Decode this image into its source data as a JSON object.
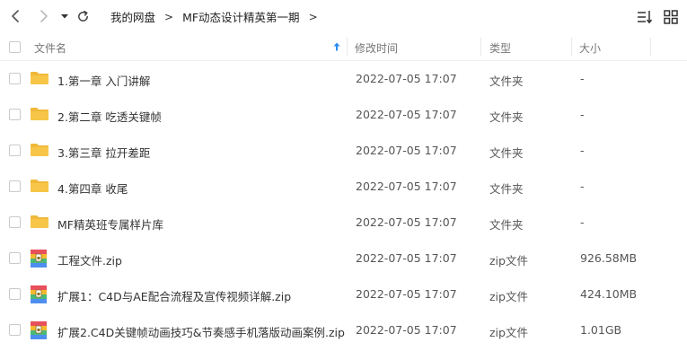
{
  "breadcrumb": {
    "items": [
      "我的网盘",
      "MF动态设计精英第一期"
    ],
    "separator": ">"
  },
  "header": {
    "name": "文件名",
    "modified": "修改时间",
    "type": "类型",
    "size": "大小"
  },
  "files": [
    {
      "name": "1.第一章 入门讲解",
      "date": "2022-07-05 17:07",
      "type": "文件夹",
      "size": "-",
      "icon": "folder-icon"
    },
    {
      "name": "2.第二章 吃透关键帧",
      "date": "2022-07-05 17:07",
      "type": "文件夹",
      "size": "-",
      "icon": "folder-icon"
    },
    {
      "name": "3.第三章 拉开差距",
      "date": "2022-07-05 17:07",
      "type": "文件夹",
      "size": "-",
      "icon": "folder-icon"
    },
    {
      "name": "4.第四章 收尾",
      "date": "2022-07-05 17:07",
      "type": "文件夹",
      "size": "-",
      "icon": "folder-icon"
    },
    {
      "name": "MF精英班专属样片库",
      "date": "2022-07-05 17:07",
      "type": "文件夹",
      "size": "-",
      "icon": "folder-icon"
    },
    {
      "name": "工程文件.zip",
      "date": "2022-07-05 17:07",
      "type": "zip文件",
      "size": "926.58MB",
      "icon": "zip-icon"
    },
    {
      "name": "扩展1：C4D与AE配合流程及宣传视频详解.zip",
      "date": "2022-07-05 17:07",
      "type": "zip文件",
      "size": "424.10MB",
      "icon": "zip-icon"
    },
    {
      "name": "扩展2.C4D关键帧动画技巧&节奏感手机落版动画案例.zip",
      "date": "2022-07-05 17:07",
      "type": "zip文件",
      "size": "1.01GB",
      "icon": "zip-icon"
    }
  ],
  "colors": {
    "folder": "#f7c648",
    "folder_tab": "#f0b93a",
    "sort_arrow": "#2a8cf0",
    "zip_red": "#e8505b",
    "zip_yellow": "#f5b92f",
    "zip_green": "#4cb877",
    "zip_blue": "#4d8ef0"
  }
}
